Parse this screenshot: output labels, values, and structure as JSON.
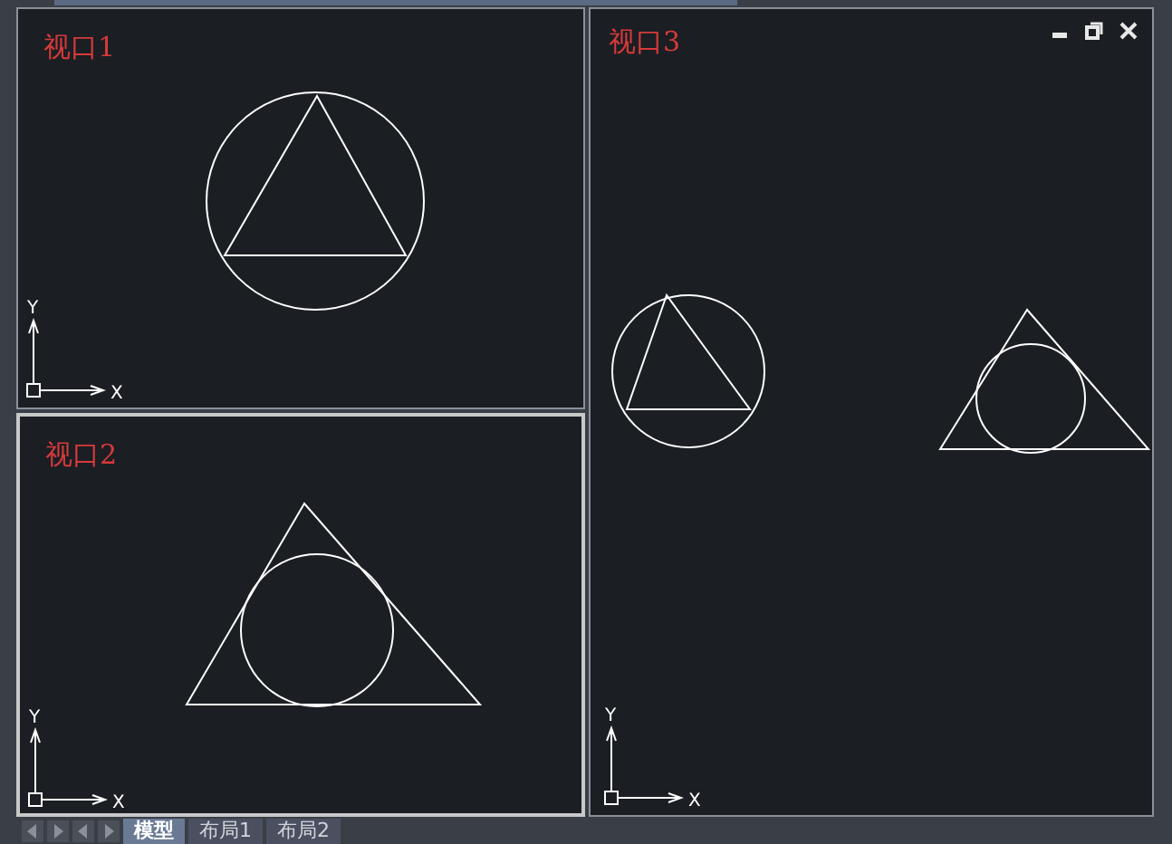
{
  "viewports": [
    {
      "title": "视口1",
      "selected": false,
      "window_controls": false,
      "ucs": {
        "x": "X",
        "y": "Y"
      }
    },
    {
      "title": "视口2",
      "selected": true,
      "window_controls": false,
      "ucs": {
        "x": "X",
        "y": "Y"
      }
    },
    {
      "title": "视口3",
      "selected": false,
      "window_controls": true,
      "ucs": {
        "x": "X",
        "y": "Y"
      }
    }
  ],
  "tabs": [
    {
      "label": "模型",
      "selected": true
    },
    {
      "label": "布局1",
      "selected": false
    },
    {
      "label": "布局2",
      "selected": false
    }
  ]
}
